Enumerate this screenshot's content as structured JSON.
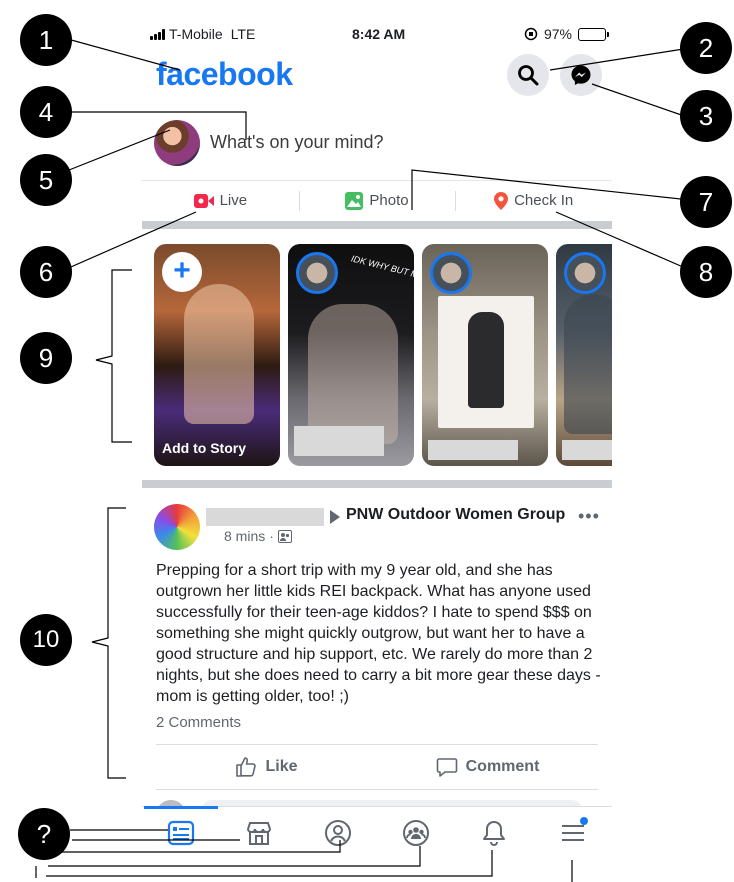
{
  "status_bar": {
    "carrier": "T-Mobile",
    "network": "LTE",
    "time": "8:42 AM",
    "battery_percent": "97%",
    "battery_level": 0.97
  },
  "header": {
    "logo": "facebook",
    "search_icon": "search-icon",
    "messenger_icon": "messenger-icon"
  },
  "composer": {
    "prompt": "What's on your mind?"
  },
  "quick_actions": [
    {
      "label": "Live",
      "icon": "live-video-icon",
      "color": "#f02849"
    },
    {
      "label": "Photo",
      "icon": "photo-icon",
      "color": "#45bd62"
    },
    {
      "label": "Check In",
      "icon": "location-pin-icon",
      "color": "#f5533d"
    }
  ],
  "stories": {
    "add_label": "Add to Story",
    "story_caption": "IDK WHY BUT MOOD"
  },
  "post": {
    "group": "PNW Outdoor Women Group",
    "time": "8 mins",
    "body": "Prepping for a short trip with my 9 year old, and she has outgrown her little kids REI backpack. What has anyone used successfully for their teen-age kiddos? I hate to spend $$$ on something she might quickly outgrow, but want her to have a good structure and hip support, etc. We rarely do more than 2 nights, but she does need to carry a bit more gear these days - mom is getting older, too! ;)",
    "comments": "2 Comments",
    "like_label": "Like",
    "comment_label": "Comment"
  },
  "tab_bar": [
    "news-feed-icon",
    "marketplace-icon",
    "profile-icon",
    "groups-icon",
    "notifications-icon",
    "menu-icon"
  ],
  "annotations": {
    "m1": "1",
    "m2": "2",
    "m3": "3",
    "m4": "4",
    "m5": "5",
    "m6": "6",
    "m7": "7",
    "m8": "8",
    "m9": "9",
    "m10": "10",
    "mq": "?"
  },
  "colors": {
    "brand": "#1877f2",
    "divider": "#c9ccd1",
    "secondary_text": "#606770"
  }
}
